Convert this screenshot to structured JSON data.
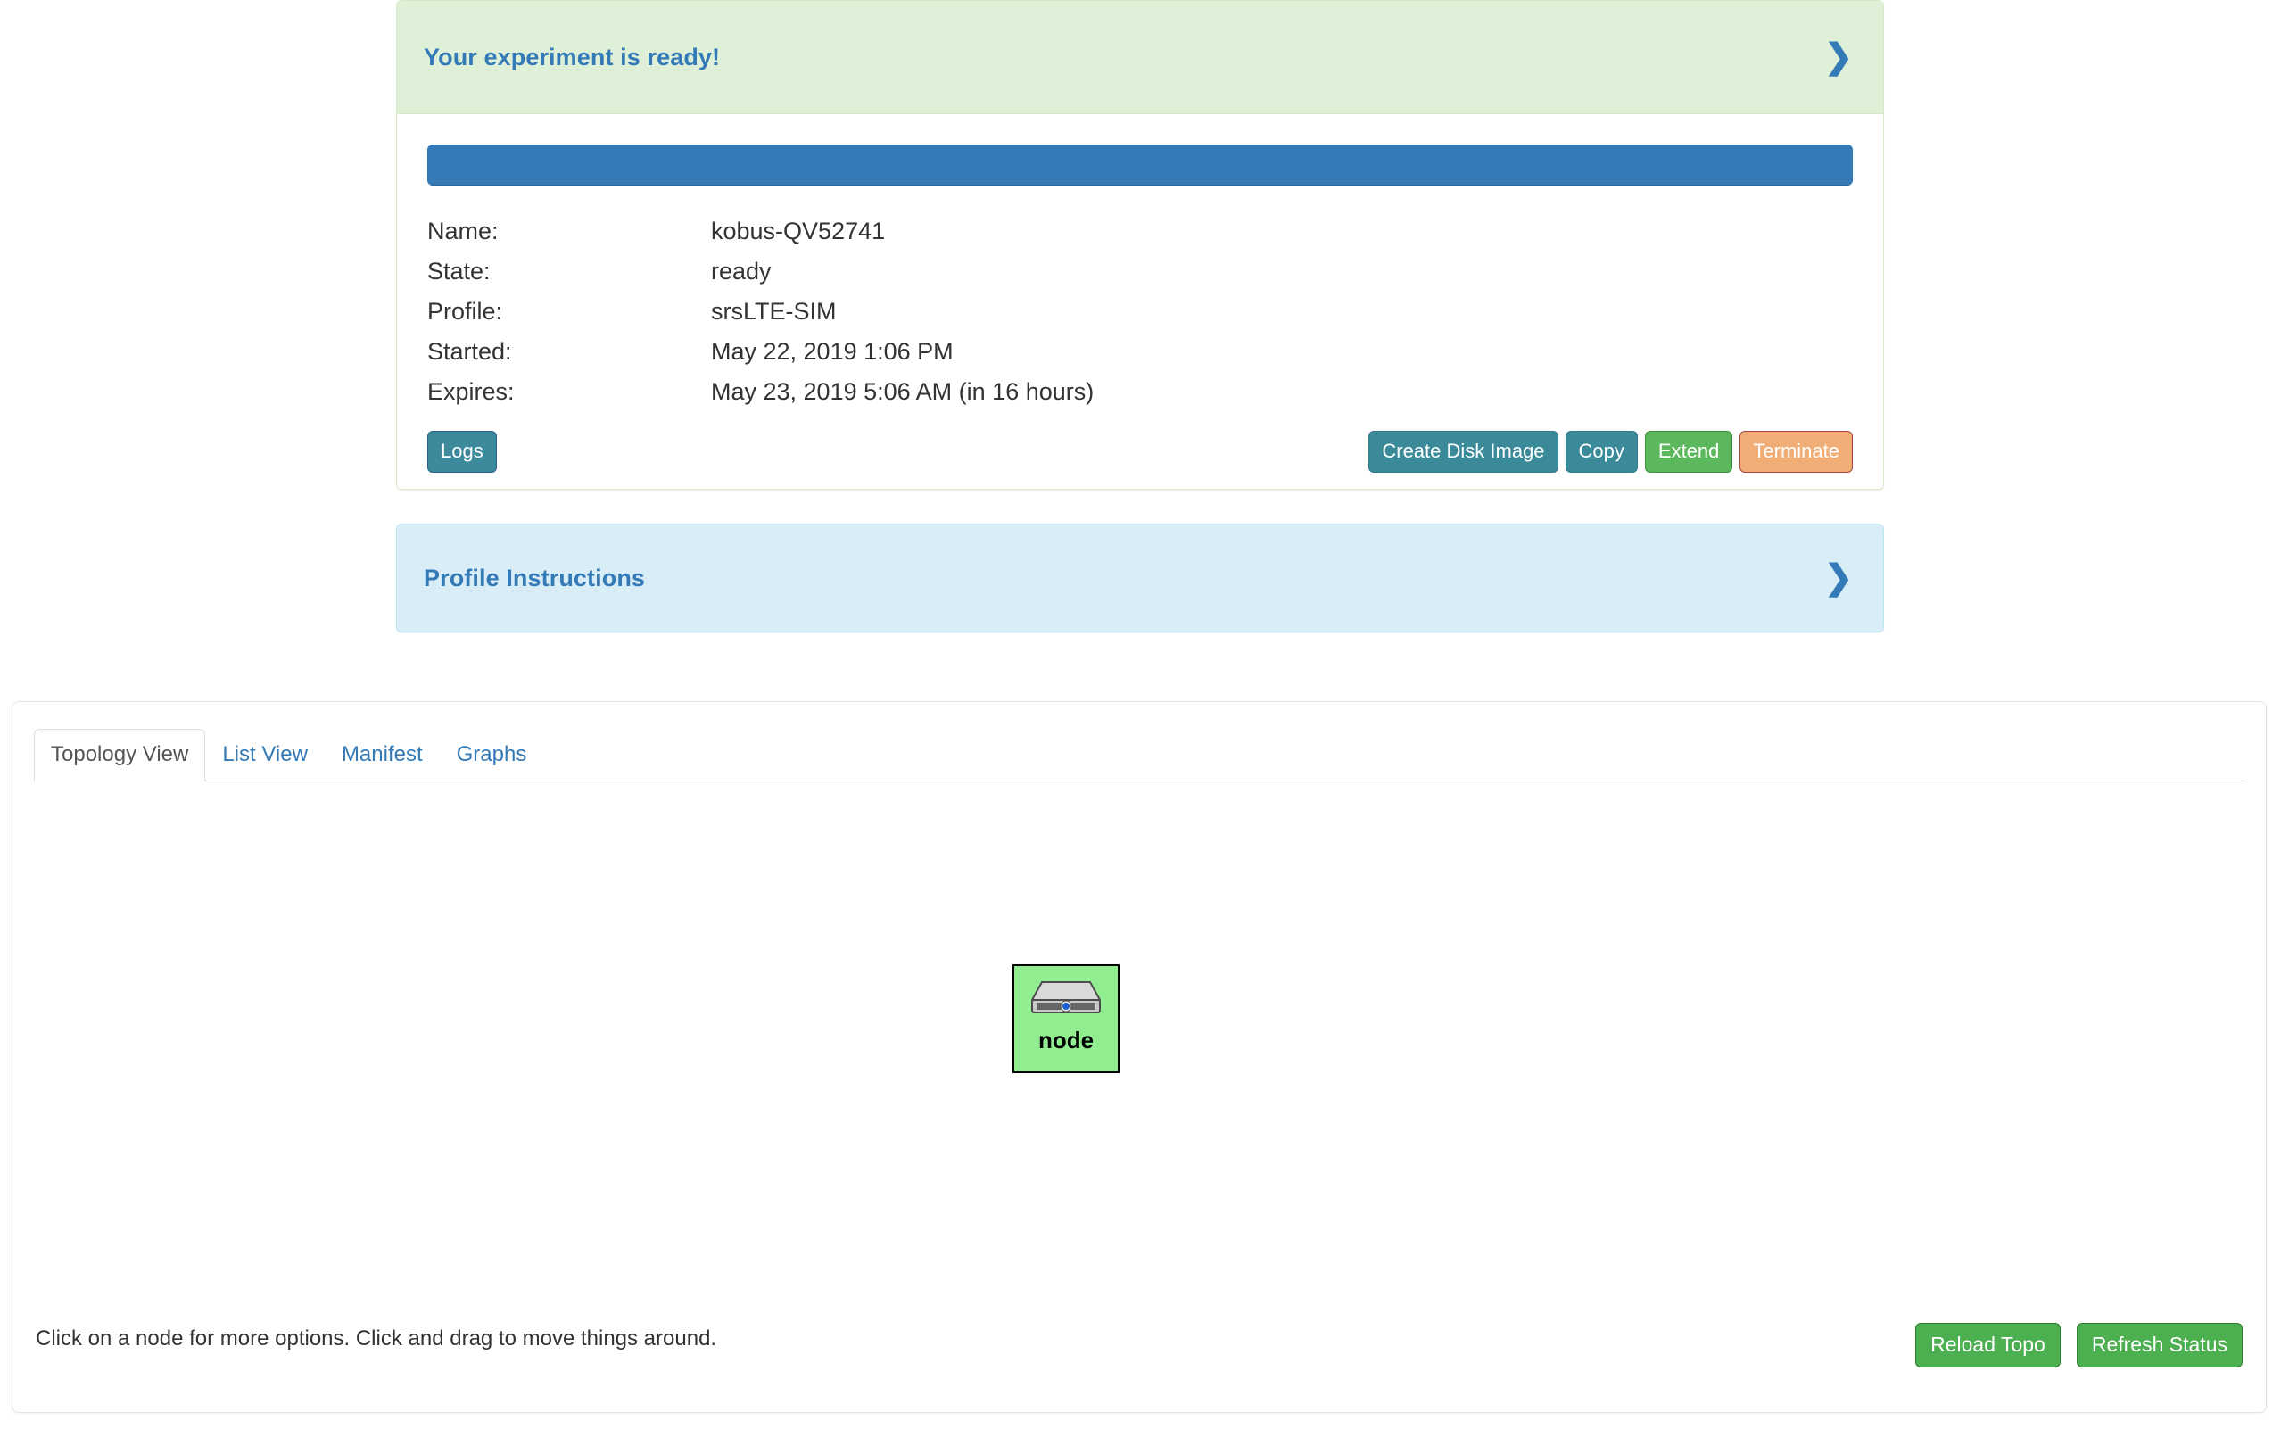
{
  "ready_panel": {
    "title": "Your experiment is ready!",
    "chevron_icon": "chevron-right-icon",
    "progress_percent": 100,
    "details": [
      {
        "label": "Name:",
        "value": "kobus-QV52741",
        "style": "plain"
      },
      {
        "label": "State:",
        "value": "ready",
        "style": "ready"
      },
      {
        "label": "Profile:",
        "value": "srsLTE-SIM",
        "style": "link"
      },
      {
        "label": "Started:",
        "value": "May 22, 2019 1:06 PM",
        "style": "plain"
      },
      {
        "label": "Expires:",
        "value": "May 23, 2019 5:06 AM (in 16 hours)",
        "style": "plain"
      }
    ],
    "buttons": {
      "logs": "Logs",
      "create_disk_image": "Create Disk Image",
      "copy": "Copy",
      "extend": "Extend",
      "terminate": "Terminate"
    }
  },
  "instructions_panel": {
    "title": "Profile Instructions",
    "chevron_icon": "chevron-right-icon"
  },
  "topology_panel": {
    "tabs": [
      {
        "label": "Topology View",
        "active": true
      },
      {
        "label": "List View",
        "active": false
      },
      {
        "label": "Manifest",
        "active": false
      },
      {
        "label": "Graphs",
        "active": false
      }
    ],
    "node": {
      "label": "node",
      "icon": "server-node-icon"
    },
    "hint": "Click on a node for more options. Click and drag to move things around.",
    "buttons": {
      "reload_topo": "Reload Topo",
      "refresh_status": "Refresh Status"
    }
  },
  "colors": {
    "success_bg": "#dff0d8",
    "success_border": "#d6e9c6",
    "info_bg": "#d9edf7",
    "info_border": "#bce8f1",
    "link": "#337ab7",
    "progress": "#337ab7",
    "state_ready": "#008000",
    "node_fill": "#90ee90",
    "btn_green": "#5cb85c",
    "btn_teal": "#3a8a99",
    "btn_orange": "#f0ad76",
    "btn_topo_green": "#4caf50"
  }
}
